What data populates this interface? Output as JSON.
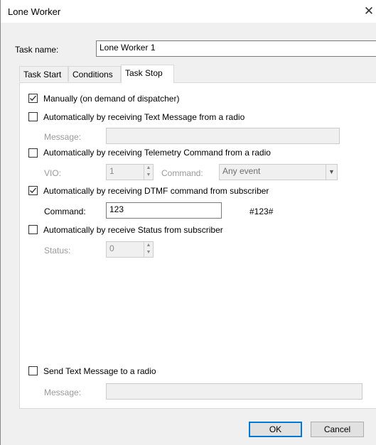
{
  "window": {
    "title": "Lone Worker",
    "close_icon": "close-icon"
  },
  "task_name": {
    "label": "Task name:",
    "value": "Lone Worker 1"
  },
  "tabs": [
    {
      "label": "Task Start",
      "active": false
    },
    {
      "label": "Conditions",
      "active": false
    },
    {
      "label": "Task Stop",
      "active": true
    }
  ],
  "task_stop": {
    "manual": {
      "label": "Manually (on demand of dispatcher)",
      "checked": true
    },
    "text_message": {
      "label": "Automatically by receiving Text Message from a radio",
      "checked": false,
      "message_label": "Message:",
      "message_value": ""
    },
    "telemetry": {
      "label": "Automatically by receiving Telemetry Command from a radio",
      "checked": false,
      "vio_label": "VIO:",
      "vio_value": "1",
      "command_label": "Command:",
      "command_value": "Any event"
    },
    "dtmf": {
      "label": "Automatically by receiving DTMF command from subscriber",
      "checked": true,
      "command_label": "Command:",
      "command_value": "123",
      "preview": "#123#"
    },
    "status": {
      "label": "Automatically by receive Status from subscriber",
      "checked": false,
      "status_label": "Status:",
      "status_value": "0"
    },
    "send_text": {
      "label": "Send Text Message to a radio",
      "checked": false,
      "message_label": "Message:",
      "message_value": ""
    }
  },
  "buttons": {
    "ok": "OK",
    "cancel": "Cancel"
  }
}
